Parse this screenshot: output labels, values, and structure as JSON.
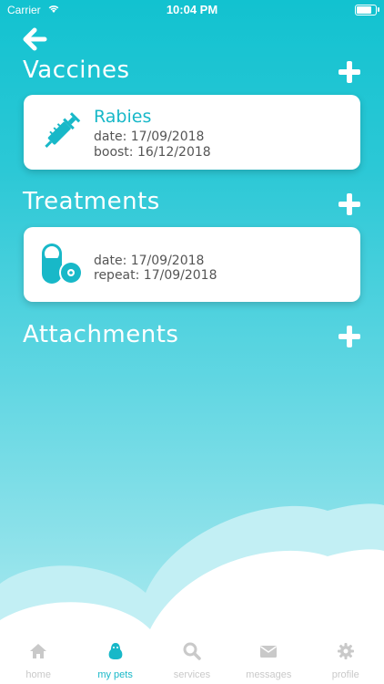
{
  "status_bar": {
    "carrier": "Carrier",
    "time": "10:04 PM"
  },
  "sections": {
    "vaccines": {
      "title": "Vaccines"
    },
    "treatments": {
      "title": "Treatments"
    },
    "attachments": {
      "title": "Attachments"
    }
  },
  "vaccine_card": {
    "name": "Rabies",
    "date": "date: 17/09/2018",
    "boost": "boost: 16/12/2018"
  },
  "treatment_card": {
    "date": "date: 17/09/2018",
    "repeat": "repeat: 17/09/2018"
  },
  "tabs": [
    {
      "label": "home",
      "icon": "home-icon",
      "active": false
    },
    {
      "label": "my pets",
      "icon": "pet-icon",
      "active": true
    },
    {
      "label": "services",
      "icon": "search-icon",
      "active": false
    },
    {
      "label": "messages",
      "icon": "envelope-icon",
      "active": false
    },
    {
      "label": "profile",
      "icon": "gear-icon",
      "active": false
    }
  ],
  "colors": {
    "accent": "#18b8c8",
    "background_top": "#12c2d0",
    "background_bottom": "#b7edf2",
    "tab_inactive": "#c9c9c9"
  }
}
